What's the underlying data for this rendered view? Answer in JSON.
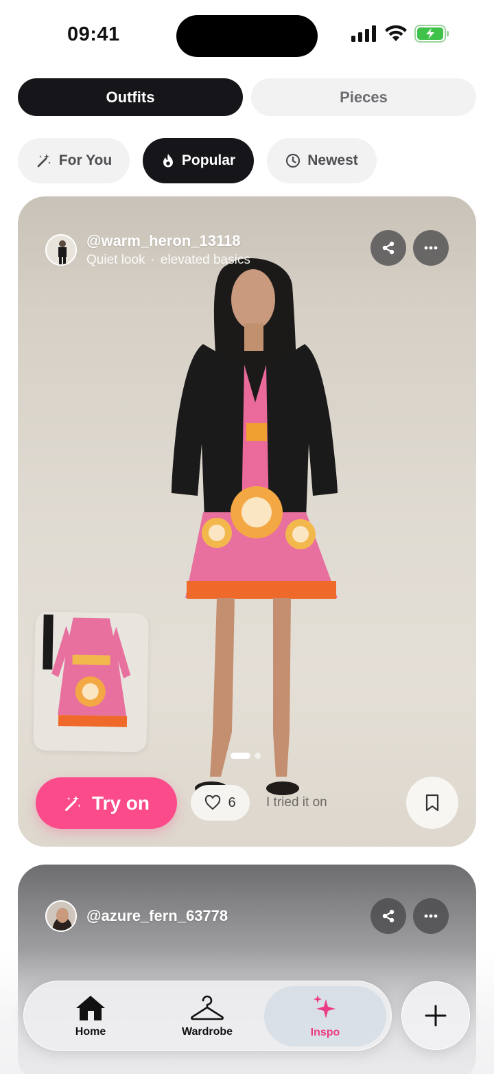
{
  "status_bar": {
    "time": "09:41"
  },
  "segments": {
    "outfits": "Outfits",
    "pieces": "Pieces"
  },
  "filters": {
    "for_you": "For You",
    "popular": "Popular",
    "newest": "Newest"
  },
  "feed": [
    {
      "username": "@warm_heron_13118",
      "caption": "Quiet look",
      "tags": "elevated basics",
      "try_on_label": "Try on",
      "likes": "6",
      "tried_label": "I tried it on",
      "pager": {
        "current": 1,
        "total": 2
      }
    },
    {
      "username": "@azure_fern_63778"
    }
  ],
  "nav": {
    "home": "Home",
    "wardrobe": "Wardrobe",
    "inspo": "Inspo"
  },
  "colors": {
    "accent": "#fb4b8a",
    "dark": "#16161a",
    "inspo": "#ec3b86"
  }
}
